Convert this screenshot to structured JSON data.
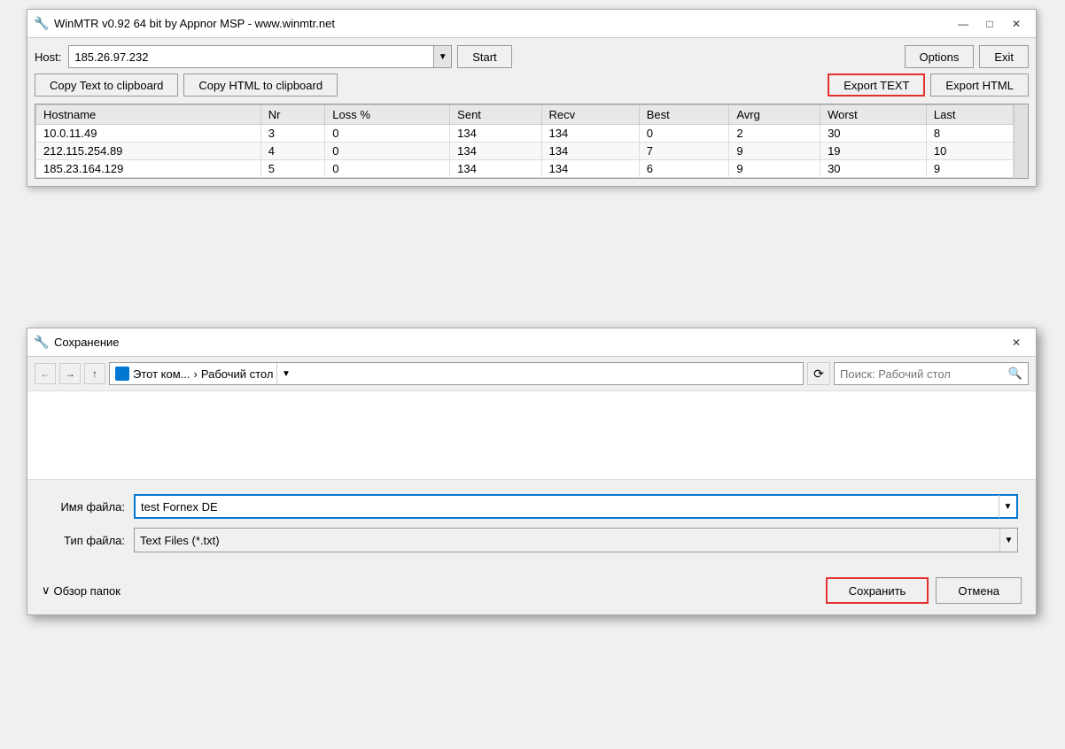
{
  "winmtr": {
    "titlebar": {
      "icon": "🔧",
      "title": "WinMTR v0.92 64 bit by Appnor MSP - www.winmtr.net",
      "minimize": "—",
      "maximize": "□",
      "close": "✕"
    },
    "toolbar": {
      "host_label": "Host:",
      "host_value": "185.26.97.232",
      "host_placeholder": "",
      "dropdown_arrow": "▼",
      "start_label": "Start",
      "options_label": "Options",
      "exit_label": "Exit",
      "copy_text_label": "Copy Text to clipboard",
      "copy_html_label": "Copy HTML to clipboard",
      "export_text_label": "Export TEXT",
      "export_html_label": "Export HTML"
    },
    "table": {
      "columns": [
        "Hostname",
        "Nr",
        "Loss %",
        "Sent",
        "Recv",
        "Best",
        "Avrg",
        "Worst",
        "Last"
      ],
      "rows": [
        [
          "10.0.11.49",
          "3",
          "0",
          "134",
          "134",
          "0",
          "2",
          "30",
          "8"
        ],
        [
          "212.115.254.89",
          "4",
          "0",
          "134",
          "134",
          "7",
          "9",
          "19",
          "10"
        ],
        [
          "185.23.164.129",
          "5",
          "0",
          "134",
          "134",
          "6",
          "9",
          "30",
          "9"
        ]
      ]
    }
  },
  "save_dialog": {
    "titlebar": {
      "icon": "🔧",
      "title": "Сохранение",
      "close": "✕"
    },
    "nav": {
      "back_arrow": "←",
      "forward_arrow": "→",
      "up_arrow": "↑",
      "breadcrumb_parts": [
        "Этот ком...",
        "Рабочий стол"
      ],
      "dropdown_arrow": "▼",
      "refresh": "⟳",
      "search_placeholder": "Поиск: Рабочий стол",
      "search_icon": "🔍"
    },
    "form": {
      "filename_label": "Имя файла:",
      "filename_value": "test Fornex DE",
      "filetype_label": "Тип файла:",
      "filetype_value": "Text Files (*.txt)",
      "dropdown_arrow": "▼"
    },
    "footer": {
      "browse_icon": "∨",
      "browse_label": "Обзор папок",
      "save_label": "Сохранить",
      "cancel_label": "Отмена"
    }
  }
}
